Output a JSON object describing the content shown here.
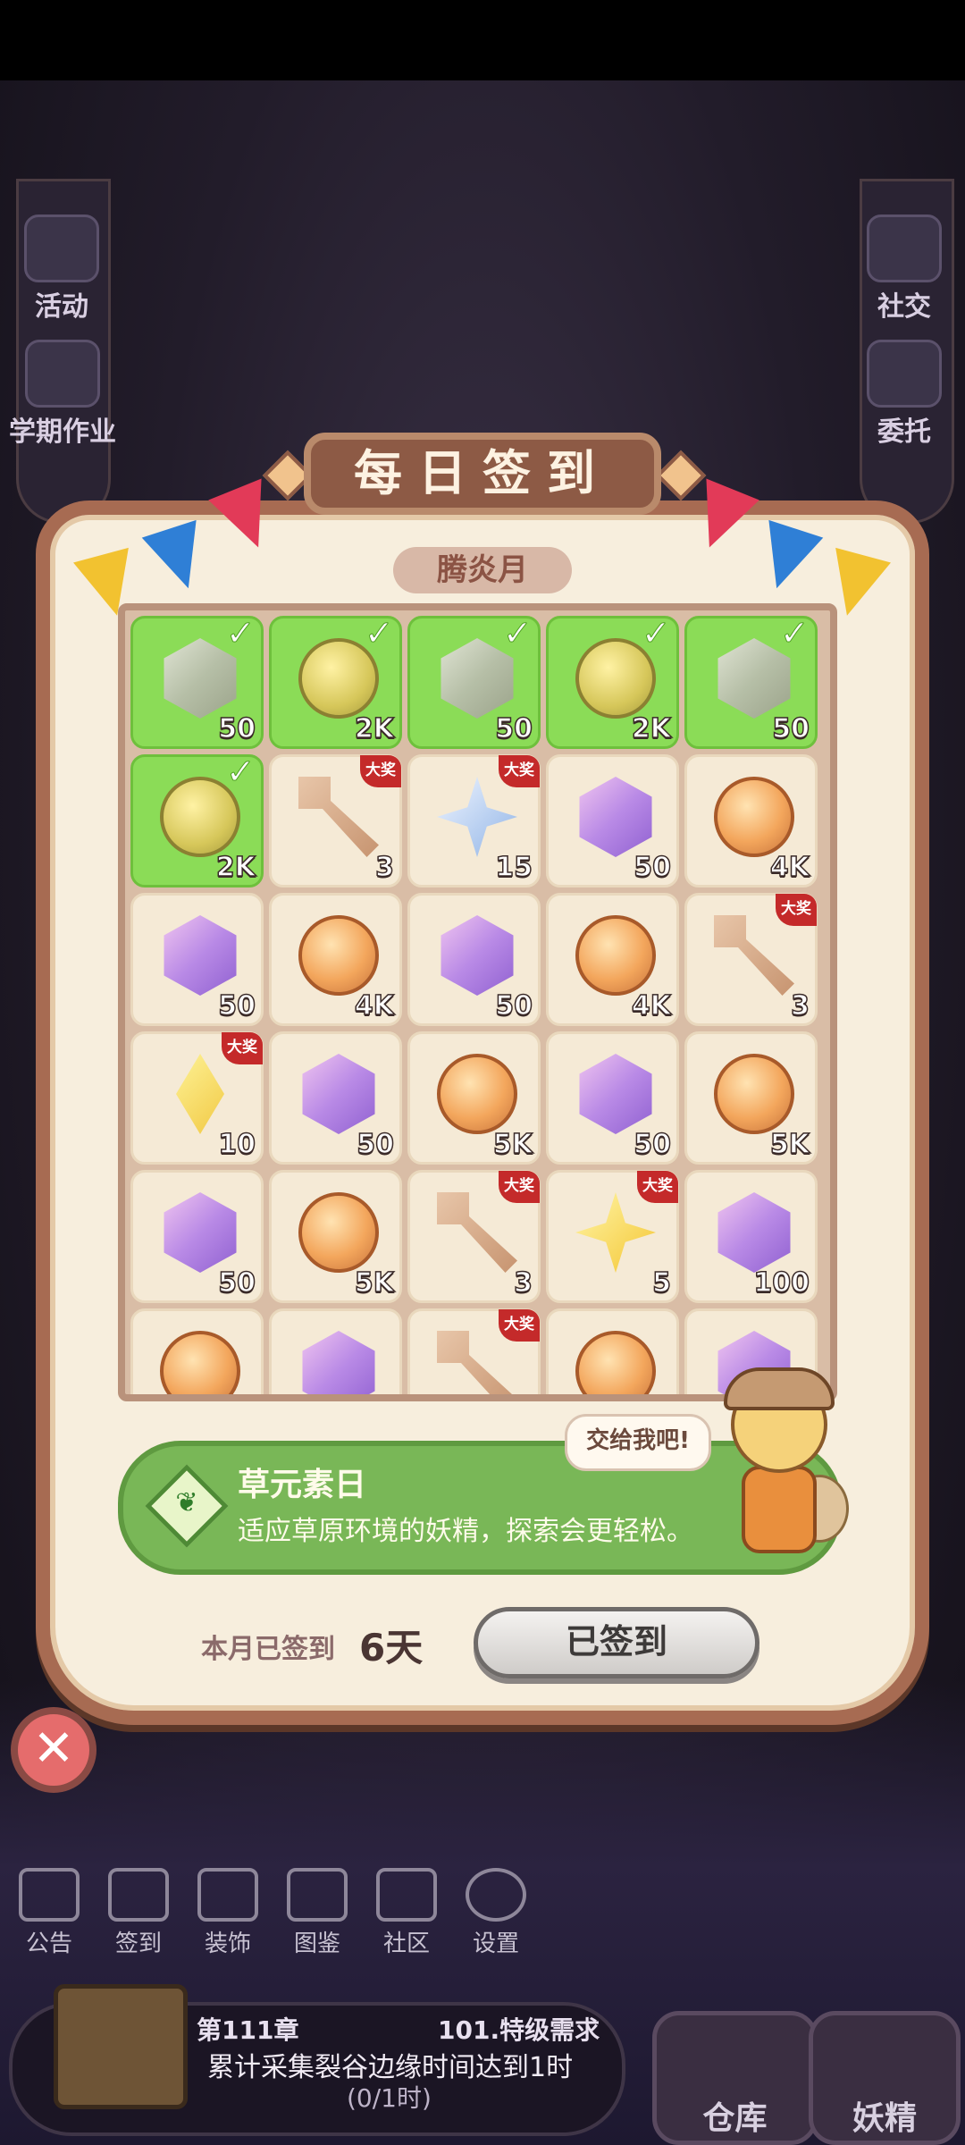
{
  "title": "每日签到",
  "month": "腾炎月",
  "side_left": [
    "活动",
    "学期作业"
  ],
  "side_right": [
    "社交",
    "委托"
  ],
  "grid": [
    {
      "qty": "50",
      "claimed": true,
      "item": "gem",
      "big": false
    },
    {
      "qty": "2K",
      "claimed": true,
      "item": "coin",
      "big": false
    },
    {
      "qty": "50",
      "claimed": true,
      "item": "gem",
      "big": false
    },
    {
      "qty": "2K",
      "claimed": true,
      "item": "coin",
      "big": false
    },
    {
      "qty": "50",
      "claimed": true,
      "item": "gem",
      "big": false
    },
    {
      "qty": "2K",
      "claimed": true,
      "item": "coin",
      "big": false
    },
    {
      "qty": "3",
      "claimed": false,
      "item": "key",
      "big": true
    },
    {
      "qty": "15",
      "claimed": false,
      "item": "star-blue",
      "big": true
    },
    {
      "qty": "50",
      "claimed": false,
      "item": "gem",
      "big": false
    },
    {
      "qty": "4K",
      "claimed": false,
      "item": "coin",
      "big": false
    },
    {
      "qty": "50",
      "claimed": false,
      "item": "gem",
      "big": false
    },
    {
      "qty": "4K",
      "claimed": false,
      "item": "coin",
      "big": false
    },
    {
      "qty": "50",
      "claimed": false,
      "item": "gem",
      "big": false
    },
    {
      "qty": "4K",
      "claimed": false,
      "item": "coin",
      "big": false
    },
    {
      "qty": "3",
      "claimed": false,
      "item": "key",
      "big": true
    },
    {
      "qty": "10",
      "claimed": false,
      "item": "diamond-yellow",
      "big": true
    },
    {
      "qty": "50",
      "claimed": false,
      "item": "gem",
      "big": false
    },
    {
      "qty": "5K",
      "claimed": false,
      "item": "coin",
      "big": false
    },
    {
      "qty": "50",
      "claimed": false,
      "item": "gem",
      "big": false
    },
    {
      "qty": "5K",
      "claimed": false,
      "item": "coin",
      "big": false
    },
    {
      "qty": "50",
      "claimed": false,
      "item": "gem",
      "big": false
    },
    {
      "qty": "5K",
      "claimed": false,
      "item": "coin",
      "big": false
    },
    {
      "qty": "3",
      "claimed": false,
      "item": "key",
      "big": true
    },
    {
      "qty": "5",
      "claimed": false,
      "item": "star-yellow",
      "big": true
    },
    {
      "qty": "100",
      "claimed": false,
      "item": "gem",
      "big": false
    },
    {
      "qty": "",
      "claimed": false,
      "item": "coin",
      "big": false
    },
    {
      "qty": "",
      "claimed": false,
      "item": "gem",
      "big": false
    },
    {
      "qty": "",
      "claimed": false,
      "item": "key",
      "big": true
    },
    {
      "qty": "",
      "claimed": false,
      "item": "coin",
      "big": false
    },
    {
      "qty": "",
      "claimed": false,
      "item": "gem",
      "big": false
    }
  ],
  "big_prize_label": "大奖",
  "check_mark": "✓",
  "banner": {
    "title": "草元素日",
    "desc": "适应草原环境的妖精，探索会更轻松。",
    "speech": "交给我吧!",
    "icon": "sprout-icon"
  },
  "footer": {
    "signed_label": "本月已签到",
    "signed_count": "6天",
    "button": "已签到"
  },
  "close_symbol": "✕",
  "bottom_nav": [
    "公告",
    "签到",
    "装饰",
    "图鉴",
    "社区",
    "设置"
  ],
  "quest": {
    "chapter": "第111章",
    "title": "101.特级需求",
    "desc": "累计采集裂谷边缘时间达到1时",
    "progress": "(0/1时)"
  },
  "big_buttons": [
    "仓库",
    "妖精"
  ],
  "colors": {
    "claimed": "#8bdc57",
    "panel": "#f7eedd",
    "frame": "#a76b52",
    "banner": "#79b757",
    "big_prize": "#c42a2a"
  }
}
